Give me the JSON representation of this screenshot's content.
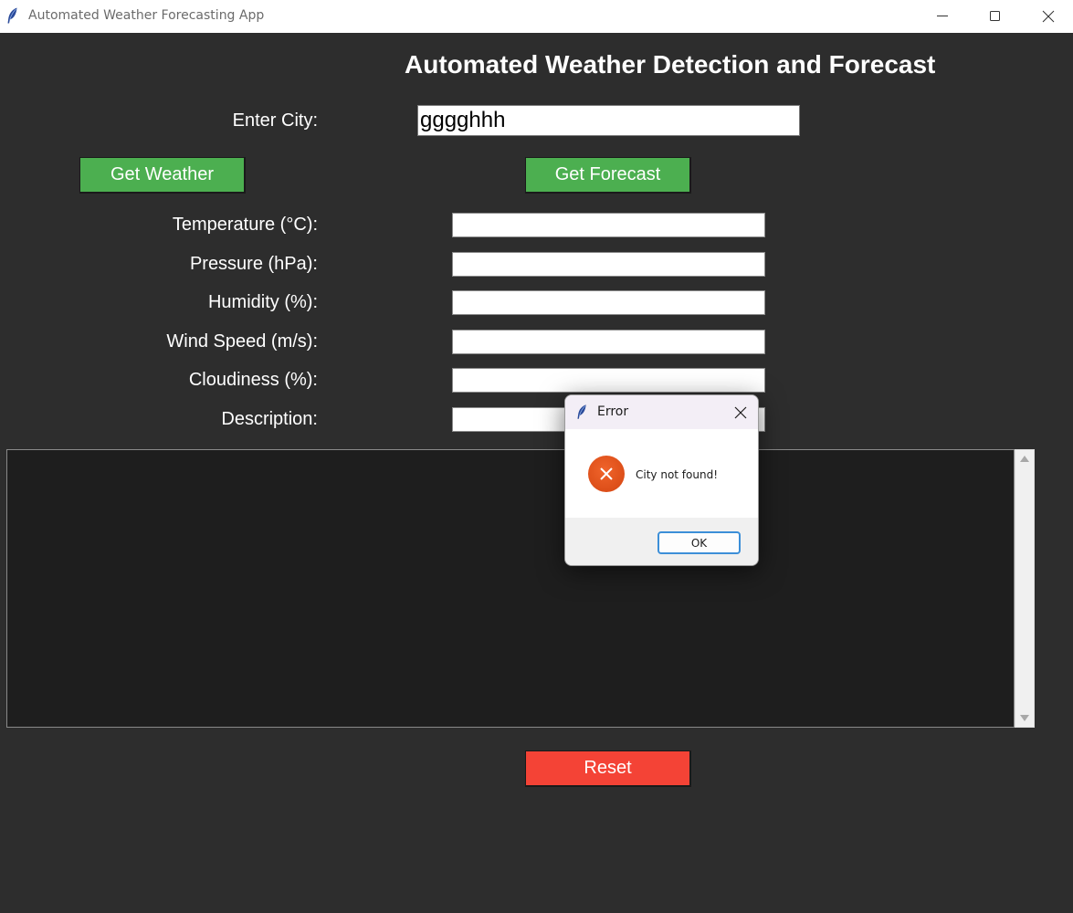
{
  "window": {
    "title": "Automated Weather Forecasting App",
    "icon": "feather-icon",
    "controls": [
      "minimize-icon",
      "maximize-icon",
      "close-icon"
    ]
  },
  "header": {
    "title": "Automated Weather Detection and Forecast"
  },
  "city": {
    "label": "Enter City:",
    "value": "gggghhh"
  },
  "buttons": {
    "get_weather": "Get Weather",
    "get_forecast": "Get Forecast",
    "reset": "Reset"
  },
  "fields": [
    {
      "label": "Temperature (°C):",
      "value": ""
    },
    {
      "label": "Pressure (hPa):",
      "value": ""
    },
    {
      "label": "Humidity (%):",
      "value": ""
    },
    {
      "label": "Wind Speed (m/s):",
      "value": ""
    },
    {
      "label": "Cloudiness (%):",
      "value": ""
    },
    {
      "label": "Description:",
      "value": ""
    }
  ],
  "forecast_text": "",
  "error_dialog": {
    "title": "Error",
    "icon": "error-x-icon",
    "message": "City not found!",
    "ok_label": "OK"
  },
  "colors": {
    "background": "#2d2d2d",
    "button_green": "#4caf50",
    "button_red": "#f44336",
    "text_area": "#1e1e1e",
    "error_icon": "#e2531d"
  }
}
